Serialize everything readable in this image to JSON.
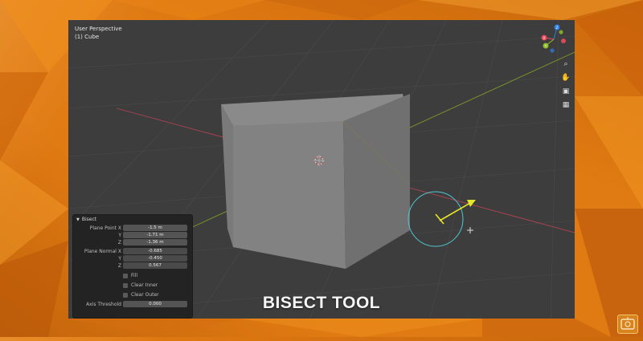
{
  "viewport": {
    "view_name": "User Perspective",
    "object_name": "(1) Cube",
    "background_color": "#3d3d3d",
    "grid_color": "#484848",
    "x_axis_color": "#b04356",
    "y_axis_color": "#7f9a2a"
  },
  "gizmo": {
    "z_label": "Z",
    "x_label": "X",
    "y_label": "Y",
    "z_color": "#2f7ee6",
    "x_color": "#e64a5d",
    "y_color": "#8fbf2a"
  },
  "viewport_tools": [
    {
      "name": "zoom-icon",
      "glyph": "⌕"
    },
    {
      "name": "hand-icon",
      "glyph": "✋"
    },
    {
      "name": "camera-icon",
      "glyph": "▣"
    },
    {
      "name": "grid-view-icon",
      "glyph": "▦"
    }
  ],
  "operator_panel": {
    "title": "Bisect",
    "plane_point_x_label": "Plane Point X",
    "plane_point_x": "-1.5 m",
    "plane_point_y_label": "Y",
    "plane_point_y": "-1.71 m",
    "plane_point_z_label": "Z",
    "plane_point_z": "-1.36 m",
    "plane_normal_x_label": "Plane Normal X",
    "plane_normal_x": "-0.685",
    "plane_normal_y_label": "Y",
    "plane_normal_y": "-0.450",
    "plane_normal_z_label": "Z",
    "plane_normal_z": "0.567",
    "fill_label": "Fill",
    "clear_inner_label": "Clear Inner",
    "clear_outer_label": "Clear Outer",
    "axis_threshold_label": "Axis Threshold",
    "axis_threshold": "0.000"
  },
  "caption": "BISECT TOOL",
  "bisect_widget_color": "#4fc9cf",
  "arrow_color": "#e6e62a"
}
